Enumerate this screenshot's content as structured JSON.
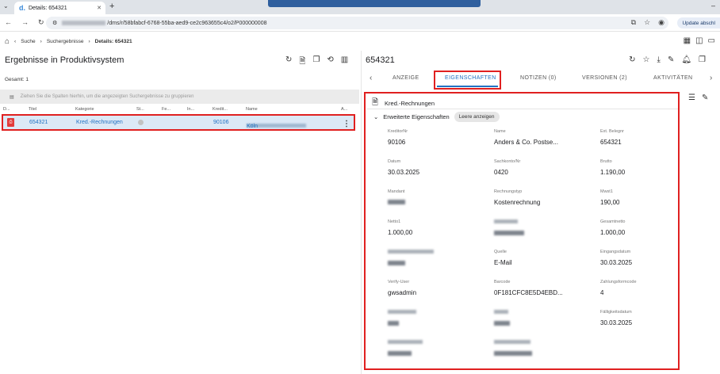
{
  "browser": {
    "tab_title": "Details: 654321",
    "tab_favicon": "d.",
    "new_tab": "+",
    "url_suffix": "/dms/r/58bfabcf-6768-55ba-aed9-ce2c963655c4/o2/P000000008",
    "update_label": "Update abschl"
  },
  "breadcrumb": {
    "items": [
      "Suche",
      "Suchergebnisse",
      "Details: 654321"
    ]
  },
  "left": {
    "title": "Ergebnisse in Produktivsystem",
    "total": "Gesamt: 1",
    "group_hint": "Ziehen Sie die Spalten hierhin, um die angezeigten Suchergebnisse zu gruppieren",
    "columns": [
      "D...",
      "Titel",
      "Kategorie",
      "St...",
      "Fe...",
      "In...",
      "Kredit...",
      "Name",
      "A..."
    ],
    "row": {
      "titel": "654321",
      "kategorie": "Kred.-Rechnungen",
      "kreditor": "90106",
      "name_suffix": "Köln"
    }
  },
  "right": {
    "title": "654321",
    "tabs": [
      "ANZEIGE",
      "EIGENSCHAFTEN",
      "NOTIZEN (0)",
      "VERSIONEN (2)",
      "AKTIVITÄTEN"
    ],
    "panel_title": "Kred.-Rechnungen",
    "section_title": "Erweiterte Eigenschaften",
    "show_empty": "Leere anzeigen",
    "fields": {
      "kreditornr_label": "KreditorNr",
      "kreditornr": "90106",
      "name_label": "Name",
      "name": "Anders & Co. Postse...",
      "ext_beleg_label": "Ext. Belegnr",
      "ext_beleg": "654321",
      "datum_label": "Datum",
      "datum": "30.03.2025",
      "sachkonto_label": "Sachkonto/Nr",
      "sachkonto": "0420",
      "brutto_label": "Brutto",
      "brutto": "1.190,00",
      "mandant_label": "Mandant",
      "rechnungstyp_label": "Rechnungstyp",
      "rechnungstyp": "Kostenrechnung",
      "mwst_label": "Mwst1",
      "mwst": "190,00",
      "netto_label": "Netto1",
      "netto": "1.000,00",
      "gesamtnetto_label": "Gesamtnetto",
      "gesamtnetto": "1.000,00",
      "quelle_label": "Quelle",
      "quelle": "E-Mail",
      "eingang_label": "Eingangsdatum",
      "eingang": "30.03.2025",
      "verify_label": "Verify-User",
      "verify": "gwsadmin",
      "barcode_label": "Barcode",
      "barcode": "0F181CFC8E5D4EBD...",
      "zahlung_label": "Zahlungsformcode",
      "zahlung": "4",
      "faellig_label": "Fälligkeitsdatum",
      "faellig": "30.03.2025"
    }
  },
  "colors": {
    "accent": "#2272c3",
    "highlight": "#e02020",
    "row_selected": "#dce9f6"
  }
}
